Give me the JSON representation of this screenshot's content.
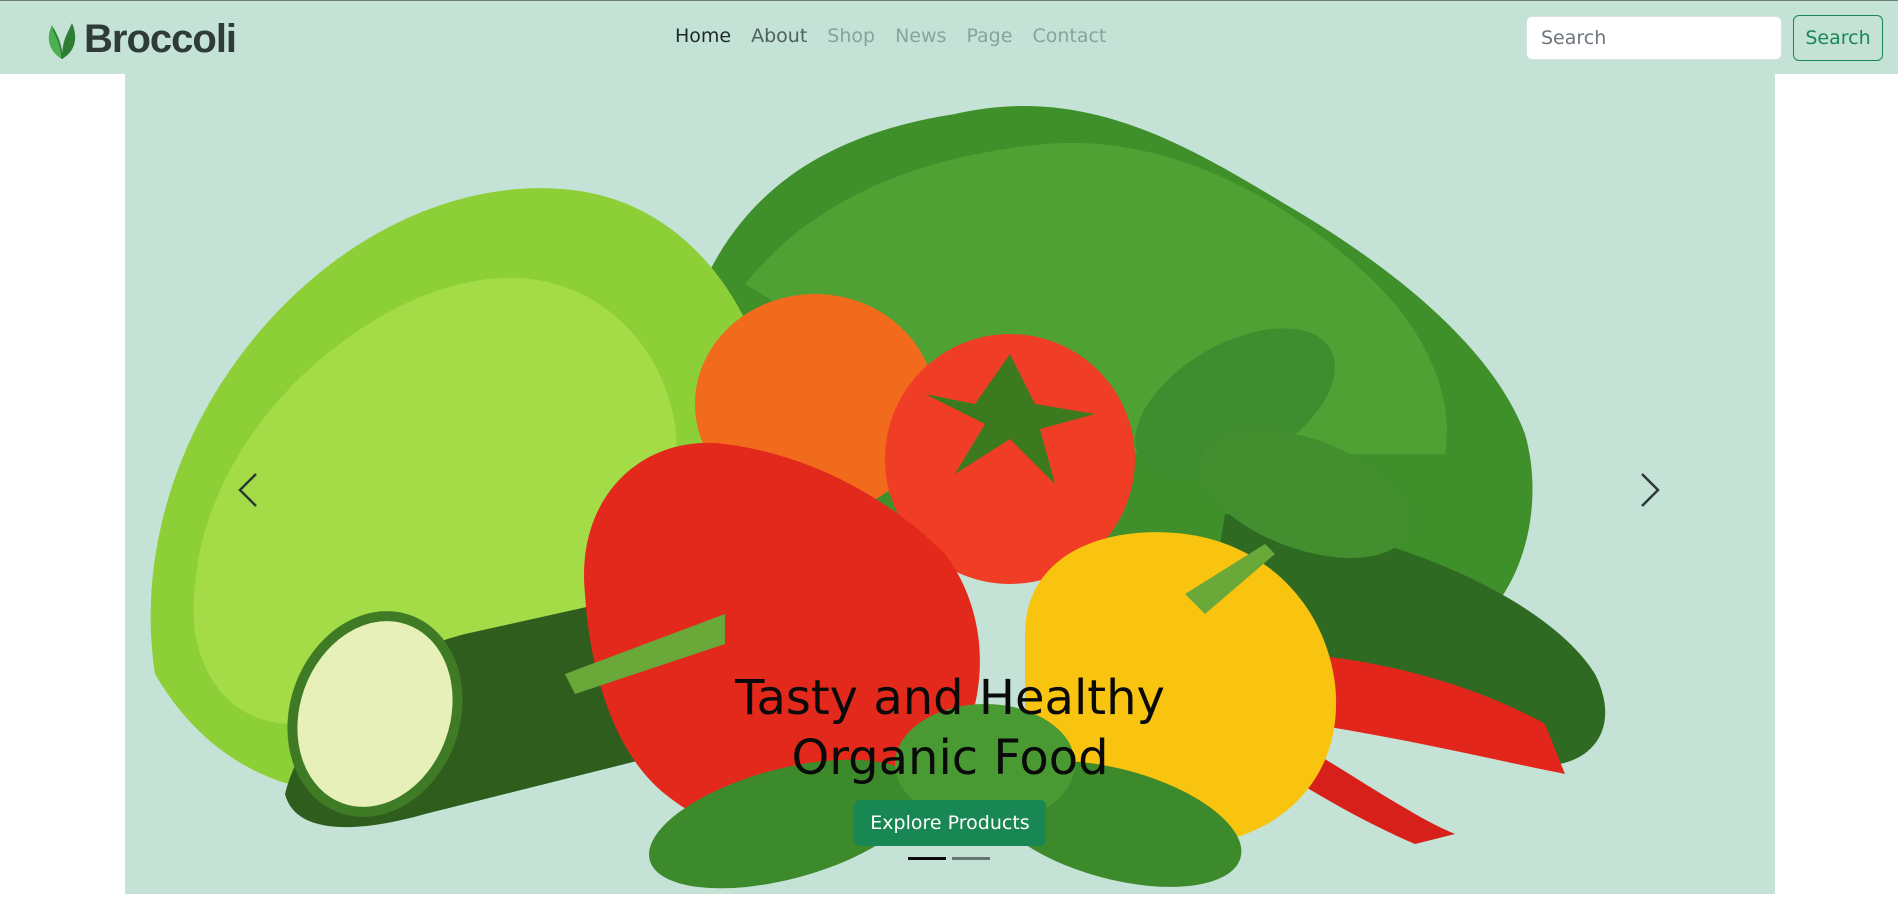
{
  "brand": {
    "name": "Broccoli",
    "logo_icon": "leaf-icon"
  },
  "nav": {
    "items": [
      {
        "label": "Home",
        "state": "active"
      },
      {
        "label": "About",
        "state": "normal"
      },
      {
        "label": "Shop",
        "state": "muted"
      },
      {
        "label": "News",
        "state": "muted"
      },
      {
        "label": "Page",
        "state": "muted"
      },
      {
        "label": "Contact",
        "state": "muted"
      }
    ]
  },
  "search": {
    "placeholder": "Search",
    "button_label": "Search"
  },
  "hero": {
    "title_line1": "Tasty and Healthy",
    "title_line2": "Organic Food",
    "cta_label": "Explore Products",
    "prev_icon": "chevron-left-icon",
    "next_icon": "chevron-right-icon",
    "slides_count": 2,
    "active_slide": 1
  },
  "colors": {
    "navbar_bg": "#c5e2d6",
    "hero_bg": "#c5e2d6",
    "accent": "#198754",
    "text_dark": "#0a0a0a"
  }
}
